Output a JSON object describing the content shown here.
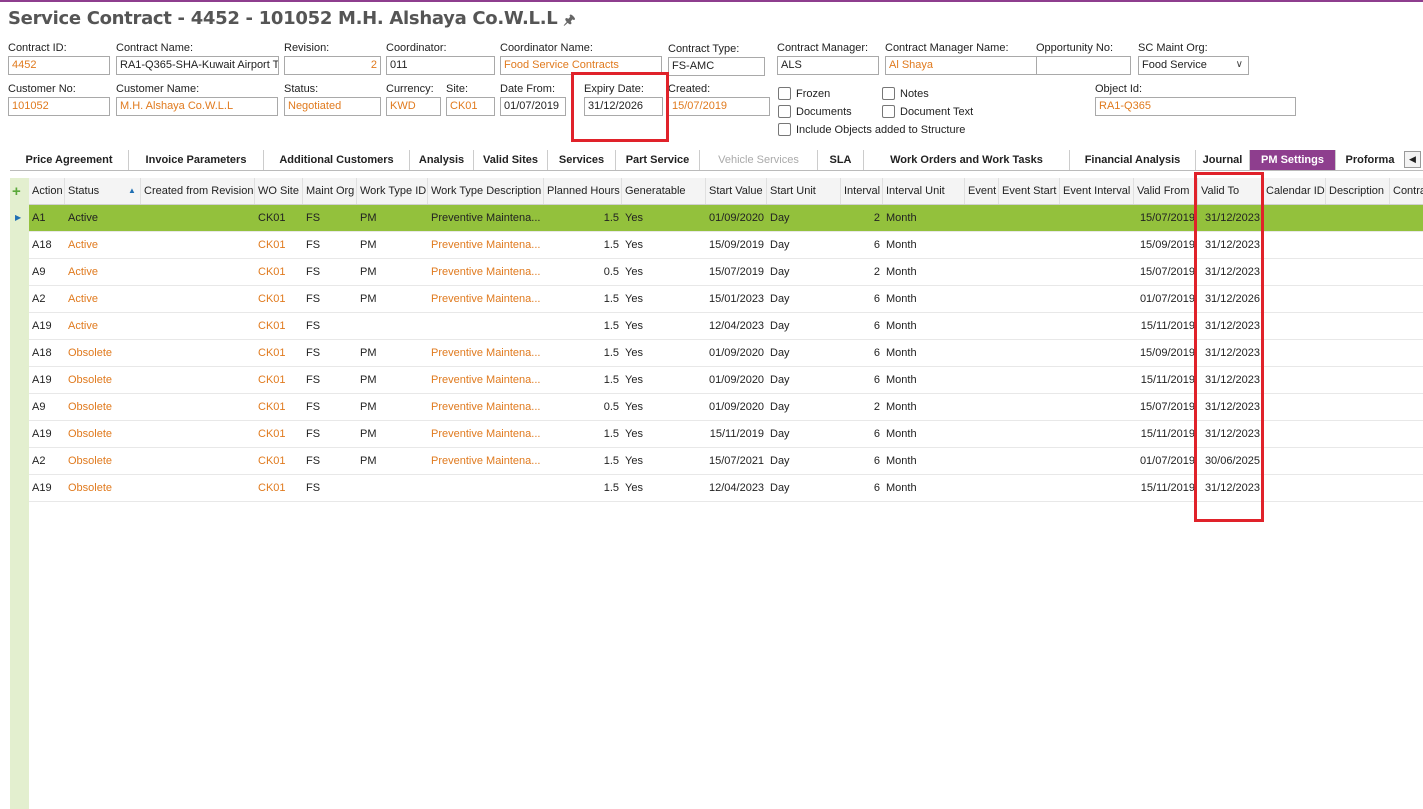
{
  "page": {
    "title": "Service Contract - 4452 - 101052  M.H. Alshaya Co.W.L.L",
    "pin_icon": "pin-icon"
  },
  "header_fields": {
    "contract_id": {
      "label": "Contract ID:",
      "value": "4452"
    },
    "contract_name": {
      "label": "Contract Name:",
      "value": "RA1-Q365-SHA-Kuwait Airport T4"
    },
    "revision": {
      "label": "Revision:",
      "value": "2"
    },
    "coordinator": {
      "label": "Coordinator:",
      "value": "011"
    },
    "coordinator_name": {
      "label": "Coordinator Name:",
      "value": "Food Service Contracts"
    },
    "contract_type": {
      "label": "Contract Type:",
      "value": "FS-AMC"
    },
    "contract_manager": {
      "label": "Contract Manager:",
      "value": "ALS"
    },
    "contract_manager_name": {
      "label": "Contract Manager Name:",
      "value": "Al Shaya"
    },
    "opportunity_no": {
      "label": "Opportunity No:",
      "value": ""
    },
    "sc_maint_org": {
      "label": "SC Maint Org:",
      "value": "Food Service"
    },
    "customer_no": {
      "label": "Customer No:",
      "value": "101052"
    },
    "customer_name": {
      "label": "Customer Name:",
      "value": "M.H. Alshaya Co.W.L.L"
    },
    "status": {
      "label": "Status:",
      "value": "Negotiated"
    },
    "currency": {
      "label": "Currency:",
      "value": "KWD"
    },
    "site": {
      "label": "Site:",
      "value": "CK01"
    },
    "date_from": {
      "label": "Date From:",
      "value": "01/07/2019"
    },
    "expiry_date": {
      "label": "Expiry Date:",
      "value": "31/12/2026"
    },
    "created": {
      "label": "Created:",
      "value": "15/07/2019"
    },
    "object_id": {
      "label": "Object Id:",
      "value": "RA1-Q365"
    }
  },
  "checkboxes": {
    "frozen": "Frozen",
    "documents": "Documents",
    "include_objects": "Include Objects added to Structure",
    "notes": "Notes",
    "document_text": "Document Text"
  },
  "tabs": [
    {
      "label": "Price Agreement"
    },
    {
      "label": "Invoice Parameters"
    },
    {
      "label": "Additional Customers"
    },
    {
      "label": "Analysis"
    },
    {
      "label": "Valid Sites"
    },
    {
      "label": "Services"
    },
    {
      "label": "Part Service"
    },
    {
      "label": "Vehicle Services"
    },
    {
      "label": "SLA"
    },
    {
      "label": "Work Orders and Work Tasks"
    },
    {
      "label": "Financial Analysis"
    },
    {
      "label": "Journal"
    },
    {
      "label": "PM Settings"
    },
    {
      "label": "Proforma"
    }
  ],
  "grid": {
    "columns": [
      "Action",
      "Status",
      "Created from Revision",
      "WO Site",
      "Maint Org",
      "Work Type ID",
      "Work Type Description",
      "Planned Hours",
      "Generatable",
      "Start Value",
      "Start Unit",
      "Interval",
      "Interval Unit",
      "Event",
      "Event Start",
      "Event Interval",
      "Valid From",
      "Valid To",
      "Calendar ID",
      "Description",
      "Contra"
    ],
    "rows": [
      {
        "action": "A1",
        "status": "Active",
        "wo_site": "CK01",
        "maint_org": "FS",
        "work_type_id": "PM",
        "work_type_desc": "Preventive Maintena...",
        "planned_hours": "1.5",
        "generatable": "Yes",
        "start_value": "01/09/2020",
        "start_unit": "Day",
        "interval": "2",
        "interval_unit": "Month",
        "valid_from": "15/07/2019",
        "valid_to": "31/12/2023"
      },
      {
        "action": "A18",
        "status": "Active",
        "wo_site": "CK01",
        "maint_org": "FS",
        "work_type_id": "PM",
        "work_type_desc": "Preventive Maintena...",
        "planned_hours": "1.5",
        "generatable": "Yes",
        "start_value": "15/09/2019",
        "start_unit": "Day",
        "interval": "6",
        "interval_unit": "Month",
        "valid_from": "15/09/2019",
        "valid_to": "31/12/2023"
      },
      {
        "action": "A9",
        "status": "Active",
        "wo_site": "CK01",
        "maint_org": "FS",
        "work_type_id": "PM",
        "work_type_desc": "Preventive Maintena...",
        "planned_hours": "0.5",
        "generatable": "Yes",
        "start_value": "15/07/2019",
        "start_unit": "Day",
        "interval": "2",
        "interval_unit": "Month",
        "valid_from": "15/07/2019",
        "valid_to": "31/12/2023"
      },
      {
        "action": "A2",
        "status": "Active",
        "wo_site": "CK01",
        "maint_org": "FS",
        "work_type_id": "PM",
        "work_type_desc": "Preventive Maintena...",
        "planned_hours": "1.5",
        "generatable": "Yes",
        "start_value": "15/01/2023",
        "start_unit": "Day",
        "interval": "6",
        "interval_unit": "Month",
        "valid_from": "01/07/2019",
        "valid_to": "31/12/2026"
      },
      {
        "action": "A19",
        "status": "Active",
        "wo_site": "CK01",
        "maint_org": "FS",
        "work_type_id": "",
        "work_type_desc": "",
        "planned_hours": "1.5",
        "generatable": "Yes",
        "start_value": "12/04/2023",
        "start_unit": "Day",
        "interval": "6",
        "interval_unit": "Month",
        "valid_from": "15/11/2019",
        "valid_to": "31/12/2023"
      },
      {
        "action": "A18",
        "status": "Obsolete",
        "wo_site": "CK01",
        "maint_org": "FS",
        "work_type_id": "PM",
        "work_type_desc": "Preventive Maintena...",
        "planned_hours": "1.5",
        "generatable": "Yes",
        "start_value": "01/09/2020",
        "start_unit": "Day",
        "interval": "6",
        "interval_unit": "Month",
        "valid_from": "15/09/2019",
        "valid_to": "31/12/2023"
      },
      {
        "action": "A19",
        "status": "Obsolete",
        "wo_site": "CK01",
        "maint_org": "FS",
        "work_type_id": "PM",
        "work_type_desc": "Preventive Maintena...",
        "planned_hours": "1.5",
        "generatable": "Yes",
        "start_value": "01/09/2020",
        "start_unit": "Day",
        "interval": "6",
        "interval_unit": "Month",
        "valid_from": "15/11/2019",
        "valid_to": "31/12/2023"
      },
      {
        "action": "A9",
        "status": "Obsolete",
        "wo_site": "CK01",
        "maint_org": "FS",
        "work_type_id": "PM",
        "work_type_desc": "Preventive Maintena...",
        "planned_hours": "0.5",
        "generatable": "Yes",
        "start_value": "01/09/2020",
        "start_unit": "Day",
        "interval": "2",
        "interval_unit": "Month",
        "valid_from": "15/07/2019",
        "valid_to": "31/12/2023"
      },
      {
        "action": "A19",
        "status": "Obsolete",
        "wo_site": "CK01",
        "maint_org": "FS",
        "work_type_id": "PM",
        "work_type_desc": "Preventive Maintena...",
        "planned_hours": "1.5",
        "generatable": "Yes",
        "start_value": "15/11/2019",
        "start_unit": "Day",
        "interval": "6",
        "interval_unit": "Month",
        "valid_from": "15/11/2019",
        "valid_to": "31/12/2023"
      },
      {
        "action": "A2",
        "status": "Obsolete",
        "wo_site": "CK01",
        "maint_org": "FS",
        "work_type_id": "PM",
        "work_type_desc": "Preventive Maintena...",
        "planned_hours": "1.5",
        "generatable": "Yes",
        "start_value": "15/07/2021",
        "start_unit": "Day",
        "interval": "6",
        "interval_unit": "Month",
        "valid_from": "01/07/2019",
        "valid_to": "30/06/2025"
      },
      {
        "action": "A19",
        "status": "Obsolete",
        "wo_site": "CK01",
        "maint_org": "FS",
        "work_type_id": "",
        "work_type_desc": "",
        "planned_hours": "1.5",
        "generatable": "Yes",
        "start_value": "12/04/2023",
        "start_unit": "Day",
        "interval": "6",
        "interval_unit": "Month",
        "valid_from": "15/11/2019",
        "valid_to": "31/12/2023"
      }
    ]
  },
  "colors": {
    "accent": "#8e3e8e",
    "link_orange": "#e07a1e",
    "selected_row": "#93c13c",
    "highlight_red": "#e0222a"
  }
}
